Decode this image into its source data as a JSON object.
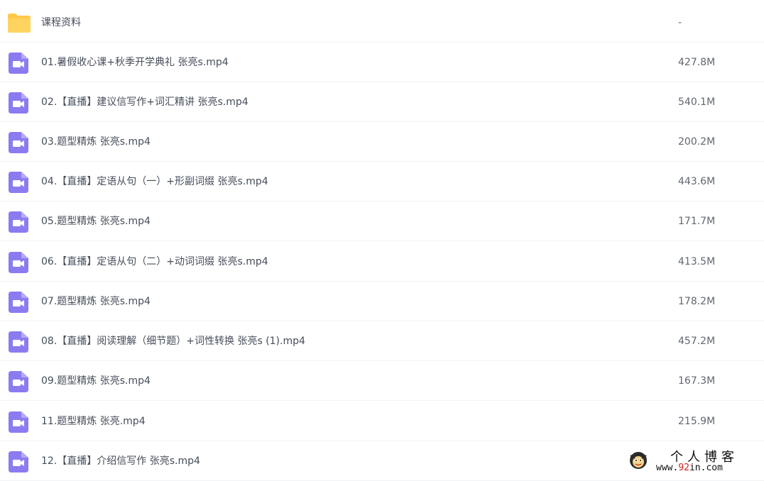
{
  "files": [
    {
      "icon": "folder-icon",
      "name": "课程资料",
      "size": "-"
    },
    {
      "icon": "video-file-icon",
      "name": "01.暑假收心课+秋季开学典礼 张亮s.mp4",
      "size": "427.8M"
    },
    {
      "icon": "video-file-icon",
      "name": "02.【直播】建议信写作+词汇精讲 张亮s.mp4",
      "size": "540.1M"
    },
    {
      "icon": "video-file-icon",
      "name": "03.题型精炼 张亮s.mp4",
      "size": "200.2M"
    },
    {
      "icon": "video-file-icon",
      "name": "04.【直播】定语从句（一）+形副词缀 张亮s.mp4",
      "size": "443.6M"
    },
    {
      "icon": "video-file-icon",
      "name": "05.题型精炼 张亮s.mp4",
      "size": "171.7M"
    },
    {
      "icon": "video-file-icon",
      "name": "06.【直播】定语从句（二）+动词词缀 张亮s.mp4",
      "size": "413.5M"
    },
    {
      "icon": "video-file-icon",
      "name": "07.题型精炼 张亮s.mp4",
      "size": "178.2M"
    },
    {
      "icon": "video-file-icon",
      "name": "08.【直播】阅读理解（细节题）+词性转换 张亮s (1).mp4",
      "size": "457.2M"
    },
    {
      "icon": "video-file-icon",
      "name": "09.题型精炼 张亮s.mp4",
      "size": "167.3M"
    },
    {
      "icon": "video-file-icon",
      "name": "11.题型精炼 张亮.mp4",
      "size": "215.9M"
    },
    {
      "icon": "video-file-icon",
      "name": "12.【直播】介绍信写作 张亮s.mp4",
      "size": ""
    }
  ],
  "watermark": {
    "title": "个人博客",
    "url_prefix": "www.",
    "url_accent": "92",
    "url_suffix": "in.com"
  },
  "colors": {
    "folder": "#ffc94a",
    "video_icon": "#8a7cf0",
    "row_divider": "#f1f2f4"
  }
}
